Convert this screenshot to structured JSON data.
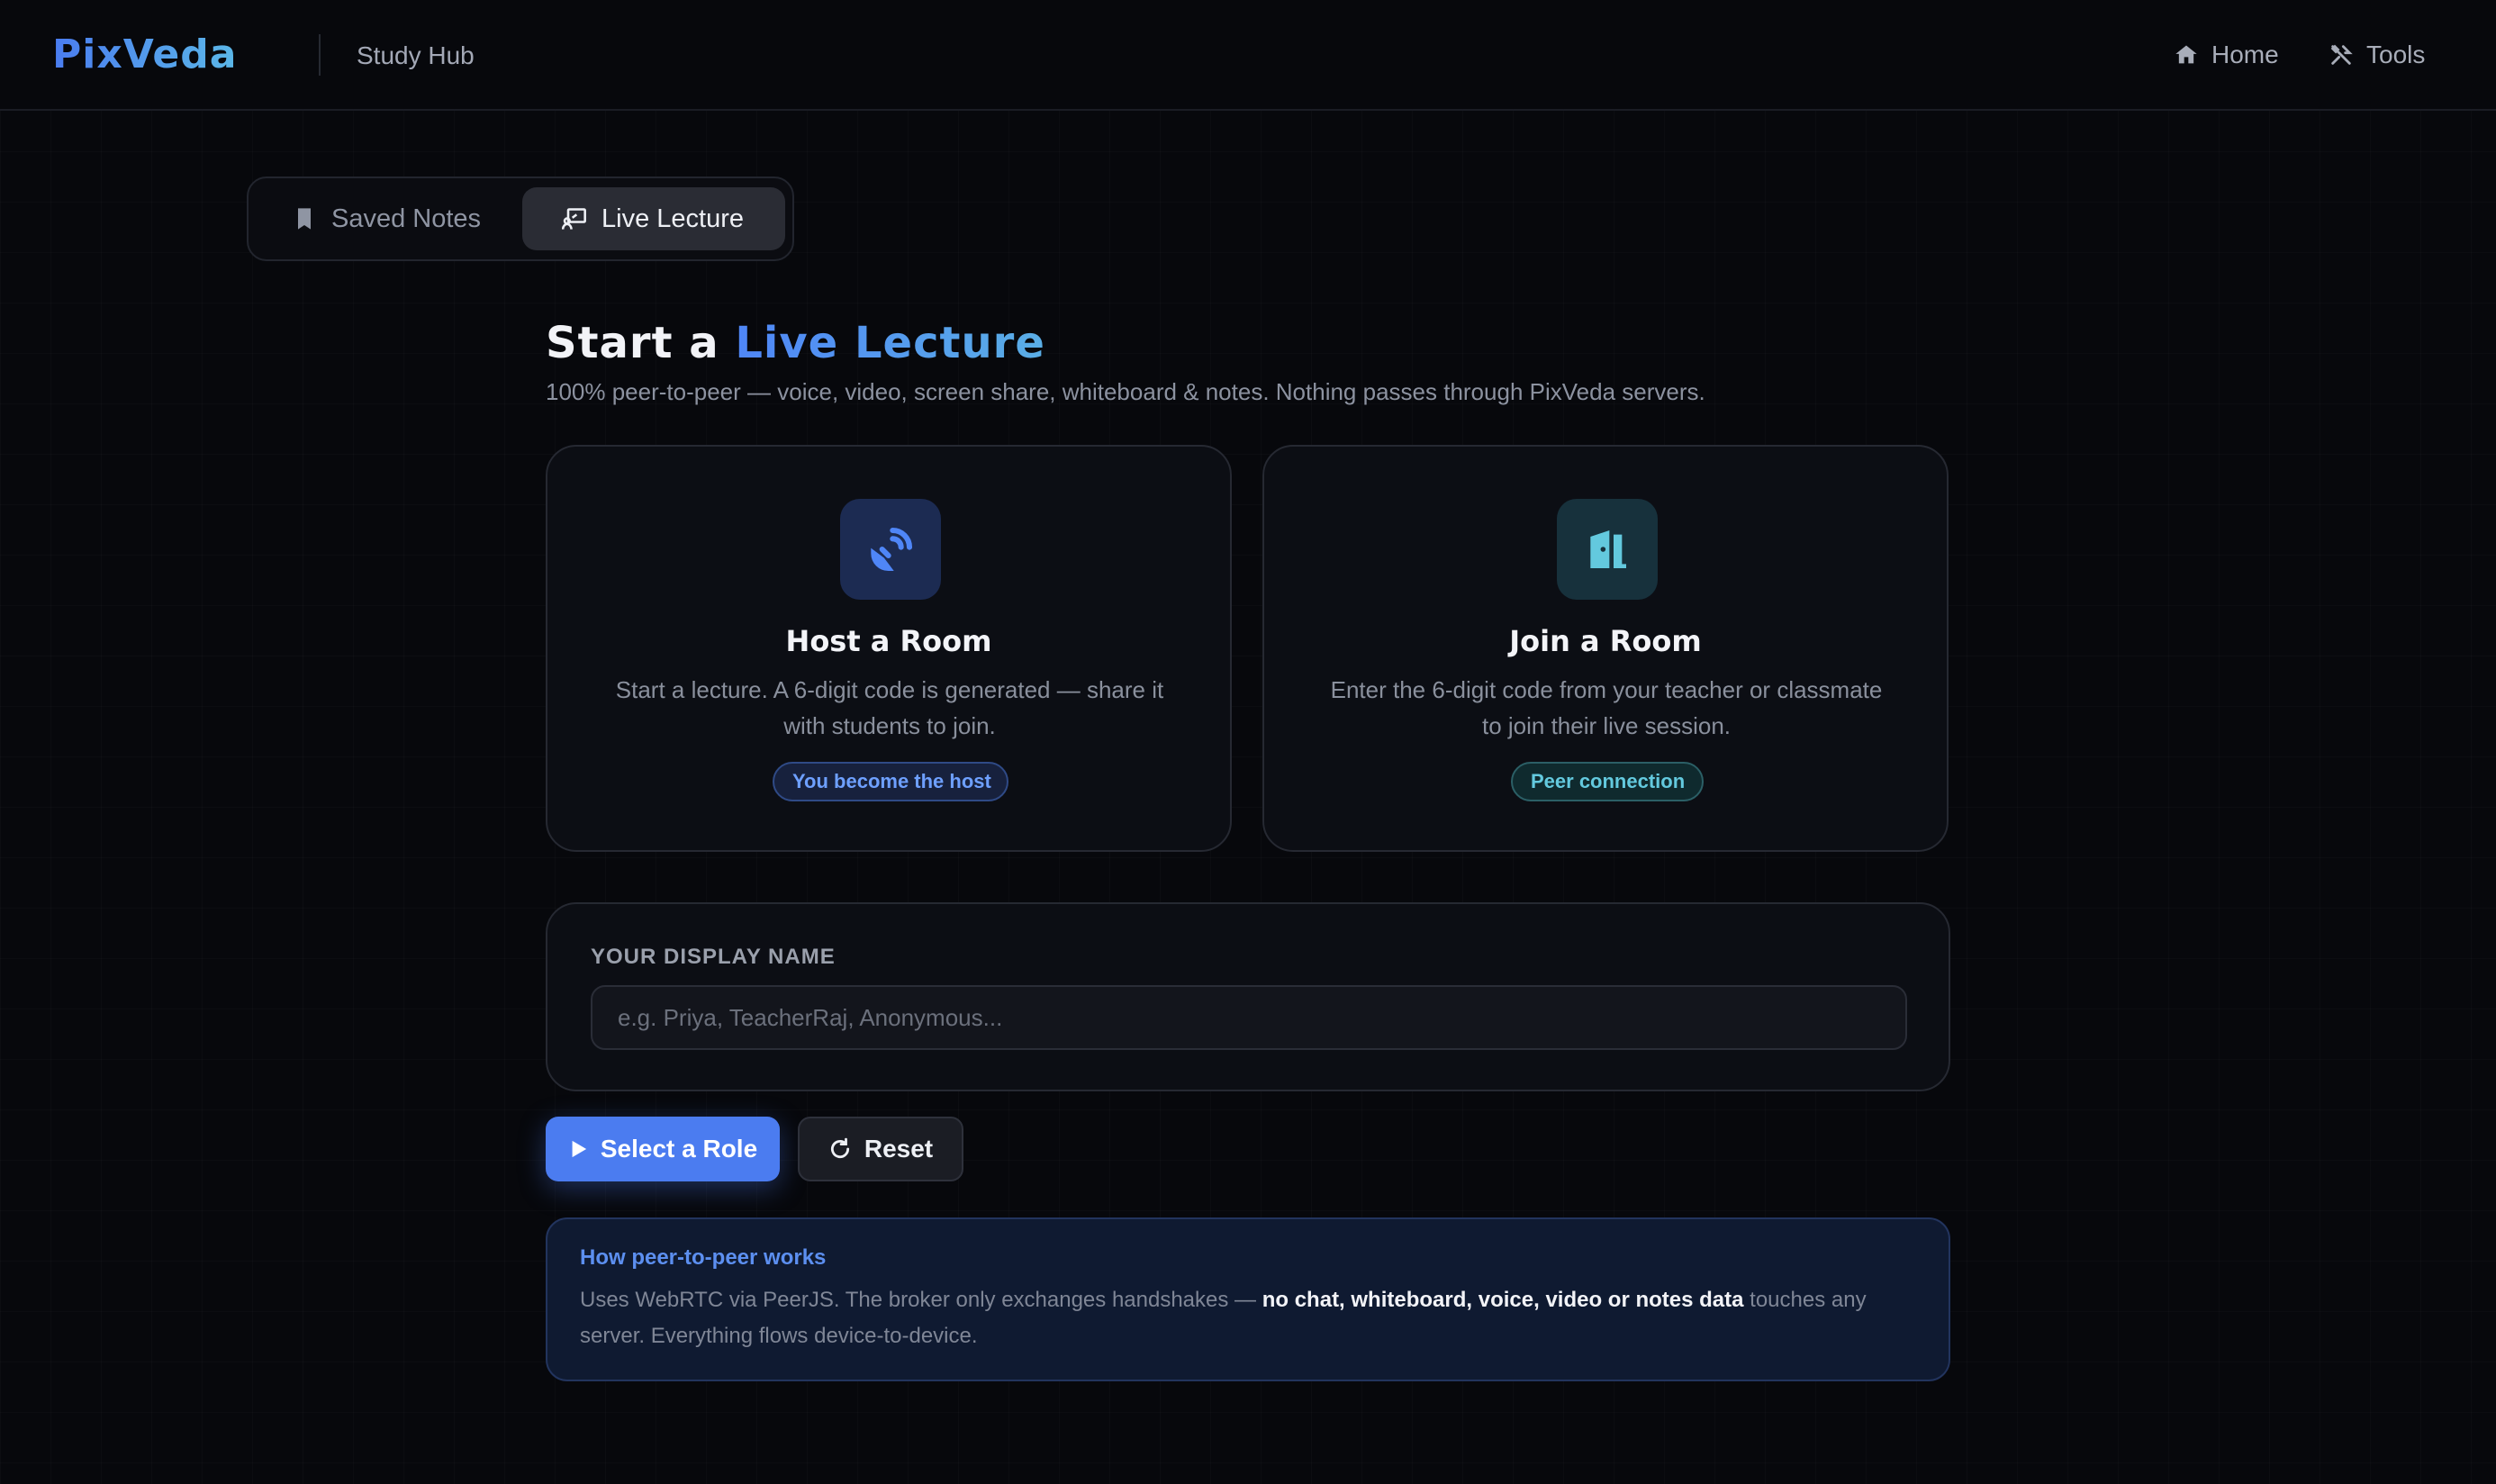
{
  "header": {
    "logo": "PixVeda",
    "section": "Study Hub",
    "nav": [
      {
        "label": "Home",
        "icon": "home-icon"
      },
      {
        "label": "Tools",
        "icon": "tools-icon"
      }
    ]
  },
  "tabs": [
    {
      "label": "Saved Notes",
      "icon": "bookmark-icon",
      "active": false
    },
    {
      "label": "Live Lecture",
      "icon": "presentation-icon",
      "active": true
    }
  ],
  "hero": {
    "title_prefix": "Start a",
    "title_accent": "Live Lecture",
    "subtitle": "100% peer-to-peer — voice, video, screen share, whiteboard & notes. Nothing passes through PixVeda servers."
  },
  "cards": {
    "host": {
      "icon": "broadcast-icon",
      "title": "Host a Room",
      "description": "Start a lecture. A 6-digit code is generated — share it with students to join.",
      "badge": "You become the host"
    },
    "join": {
      "icon": "door-icon",
      "title": "Join a Room",
      "description": "Enter the 6-digit code from your teacher or classmate to join their live session.",
      "badge": "Peer connection"
    }
  },
  "display_name": {
    "label": "YOUR DISPLAY NAME",
    "placeholder": "e.g. Priya, TeacherRaj, Anonymous...",
    "value": ""
  },
  "actions": {
    "select_label": "Select a Role",
    "reset_label": "Reset"
  },
  "info": {
    "title": "How peer-to-peer works",
    "body_start": "Uses WebRTC via PeerJS. The broker only exchanges handshakes — ",
    "body_bold": "no chat, whiteboard, voice, video or notes data",
    "body_end": " touches any server. Everything flows device-to-device."
  },
  "colors": {
    "accent": "#4b7cf0",
    "teal": "#63c9de",
    "background": "#07080c"
  }
}
